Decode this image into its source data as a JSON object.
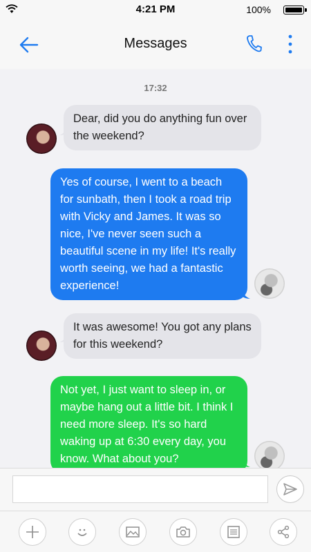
{
  "status_bar": {
    "time": "4:21 PM",
    "battery": "100%",
    "battery_level": 1.0,
    "wifi_icon": "wifi-icon"
  },
  "header": {
    "title": "Messages",
    "back_icon": "back-arrow-icon",
    "call_icon": "phone-icon",
    "menu_icon": "more-vertical-icon"
  },
  "chat": {
    "timestamp": "17:32",
    "messages": [
      {
        "sender": "contact",
        "text": "Dear, did you do anything fun over the weekend?"
      },
      {
        "sender": "me",
        "text": "Yes of course, I went to a beach for sunbath, then I took a road trip with Vicky and James. It was so nice, I've never seen such a beautiful scene in my life! It's really worth seeing, we had a fantastic experience!"
      },
      {
        "sender": "contact",
        "text": "It was awesome! You got any plans for this weekend?"
      },
      {
        "sender": "me",
        "text": "Not yet, I just want to sleep in, or maybe hang out a little bit. I think I need more sleep. It's so hard waking up at 6:30 every day, you know. What about you?"
      }
    ]
  },
  "composer": {
    "value": "",
    "placeholder": "",
    "send_icon": "send-icon"
  },
  "toolbar": {
    "items": [
      "add-icon",
      "emoji-icon",
      "image-icon",
      "camera-icon",
      "note-icon",
      "share-icon"
    ]
  },
  "colors": {
    "accent": "#1e7bf0",
    "outgoing_blue": "#1e7bf0",
    "outgoing_green": "#21d24b",
    "incoming": "#e4e4e9"
  }
}
